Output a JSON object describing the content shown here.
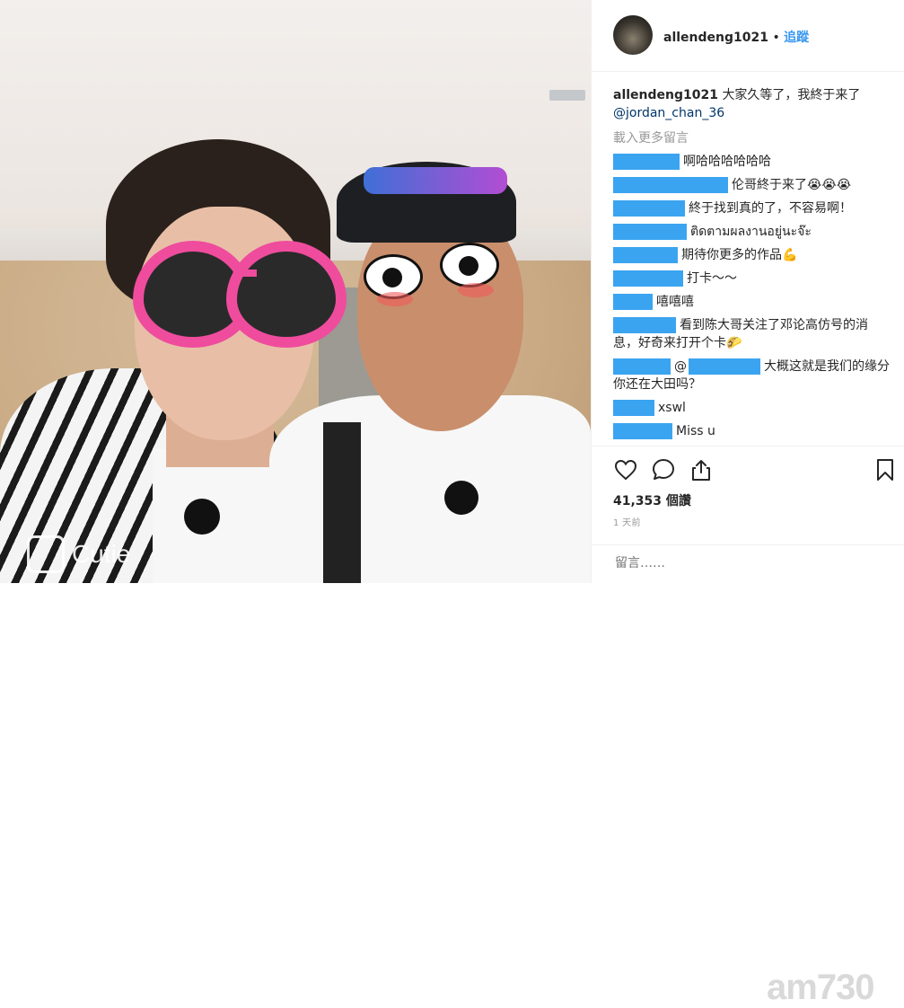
{
  "post": {
    "watermark": "Cutie",
    "site_watermark": "am730"
  },
  "header": {
    "username": "allendeng1021",
    "separator": "•",
    "follow_label": "追蹤"
  },
  "caption": {
    "username": "allendeng1021",
    "text": "大家久等了，我終于来了",
    "mention": "@jordan_chan_36"
  },
  "load_more": "載入更多留言",
  "comments": [
    {
      "text": "啊哈哈哈哈哈哈"
    },
    {
      "text": "伦哥終于来了😭😭😭"
    },
    {
      "text": "終于找到真的了，不容易啊！"
    },
    {
      "text": "ติดตามผลงานอยู่นะจ๊ะ"
    },
    {
      "text": "期待你更多的作品💪"
    },
    {
      "text": "打卡～～"
    },
    {
      "text": "嘻嘻嘻"
    },
    {
      "text": "看到陈大哥关注了邓论高仿号的消息，好奇来打开个卡🌮"
    },
    {
      "text": "@",
      "text2": "大概这就是我们的缘分 你还在大田吗？"
    },
    {
      "text": "xswl"
    },
    {
      "text": "Miss u"
    }
  ],
  "actions": {
    "like_icon": "heart-icon",
    "comment_icon": "comment-icon",
    "share_icon": "share-icon",
    "save_icon": "bookmark-icon"
  },
  "likes": "41,353 個讚",
  "time": "1 天前",
  "comment_input": {
    "placeholder": "留言……"
  }
}
